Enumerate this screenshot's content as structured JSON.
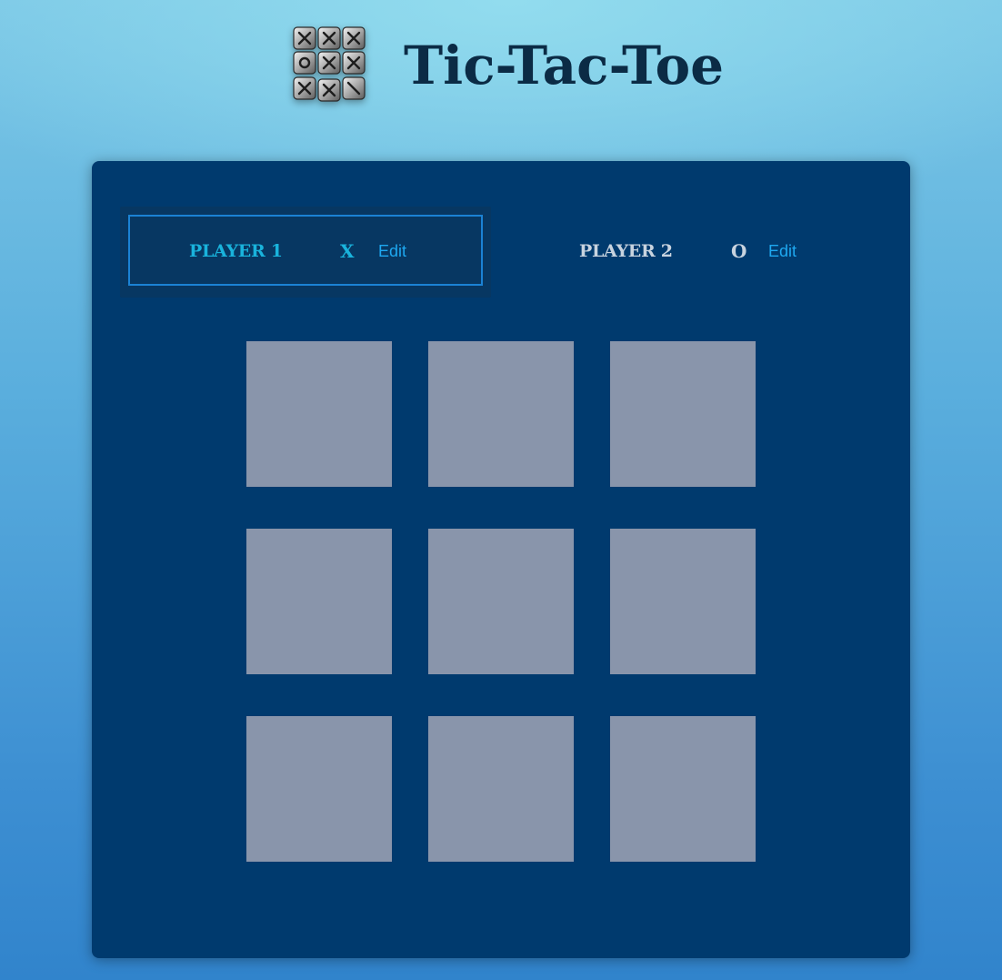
{
  "app": {
    "title": "Tic-Tac-Toe",
    "logo_icon": "tic-tac-toe-logo-icon"
  },
  "players": [
    {
      "name": "PLAYER 1",
      "symbol": "X",
      "edit_label": "Edit",
      "active": true
    },
    {
      "name": "PLAYER 2",
      "symbol": "O",
      "edit_label": "Edit",
      "active": false
    }
  ],
  "board": {
    "cells": [
      "",
      "",
      "",
      "",
      "",
      "",
      "",
      "",
      ""
    ]
  },
  "colors": {
    "panel": "#003a6e",
    "active_player": "#19b3dc",
    "inactive_player": "#c8d3df",
    "edit_link": "#1ea8f0",
    "cell": "#8995ab",
    "title": "#0b2b45"
  }
}
